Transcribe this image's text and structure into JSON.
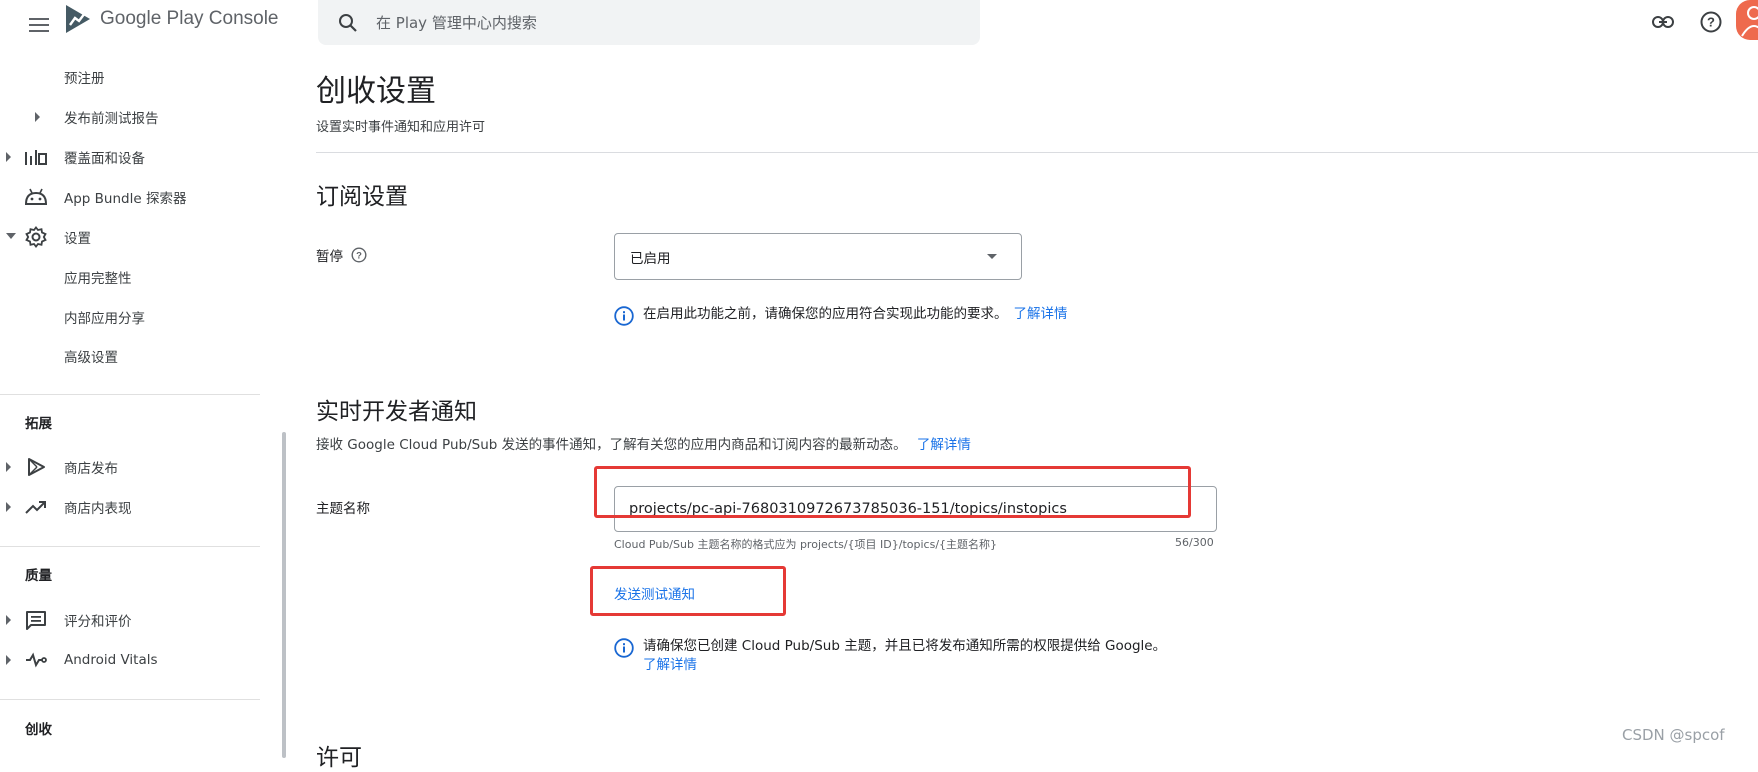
{
  "header": {
    "logo_text": "Google Play Console",
    "search_placeholder": "在 Play 管理中心内搜索",
    "icons": [
      "menu-icon",
      "search-icon",
      "link-icon",
      "help-icon",
      "avatar"
    ]
  },
  "sidebar": {
    "items": [
      {
        "label": "预注册"
      },
      {
        "label": "发布前测试报告"
      },
      {
        "label": "覆盖面和设备"
      },
      {
        "label": "App Bundle 探索器"
      },
      {
        "label": "设置"
      },
      {
        "label": "应用完整性"
      },
      {
        "label": "内部应用分享"
      },
      {
        "label": "高级设置"
      }
    ],
    "sections": [
      {
        "title": "拓展",
        "items": [
          {
            "label": "商店发布"
          },
          {
            "label": "商店内表现"
          }
        ]
      },
      {
        "title": "质量",
        "items": [
          {
            "label": "评分和评价"
          },
          {
            "label": "Android Vitals"
          }
        ]
      },
      {
        "title": "创收"
      }
    ]
  },
  "main": {
    "title": "创收设置",
    "subtitle": "设置实时事件通知和应用许可",
    "subscription": {
      "heading": "订阅设置",
      "pause_label": "暂停",
      "select_value": "已启用",
      "info_text": "在启用此功能之前，请确保您的应用符合实现此功能的要求。",
      "learn_more": "了解详情"
    },
    "rtdn": {
      "heading": "实时开发者通知",
      "description": "接收 Google Cloud Pub/Sub 发送的事件通知，了解有关您的应用内商品和订阅内容的最新动态。",
      "learn_more": "了解详情",
      "topic_label": "主题名称",
      "topic_value": "projects/pc-api-7680310972673785036-151/topics/instopics",
      "helper_text": "Cloud Pub/Sub 主题名称的格式应为 projects/{项目 ID}/topics/{主题名称}",
      "char_count": "56/300",
      "send_test_button": "发送测试通知",
      "info_text": "请确保您已创建 Cloud Pub/Sub 主题，并且已将发布通知所需的权限提供给 Google。",
      "info_learn_more": "了解详情"
    },
    "license_heading_partial": "许可"
  },
  "watermark": "CSDN @spcof",
  "colors": {
    "link": "#1a73e8",
    "highlight_box": "#e53935",
    "text": "#202124"
  }
}
